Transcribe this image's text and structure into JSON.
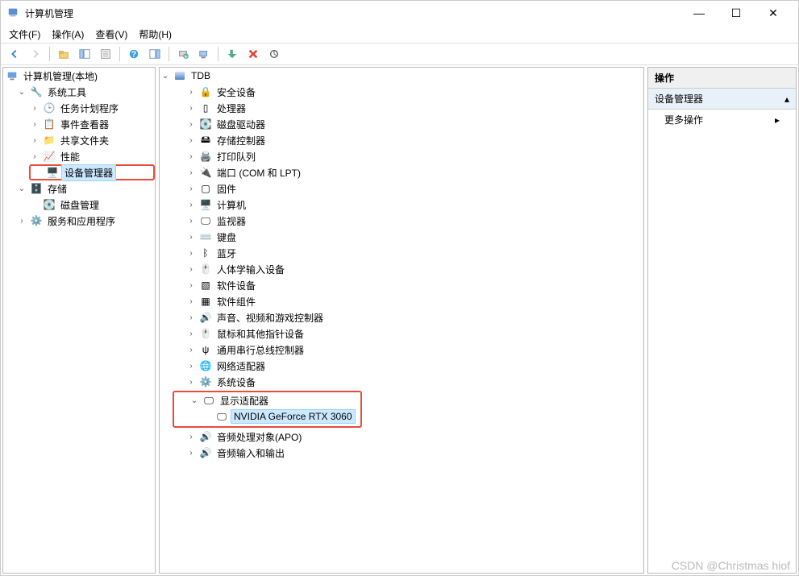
{
  "window": {
    "title": "计算机管理"
  },
  "menus": {
    "file": "文件(F)",
    "action": "操作(A)",
    "view": "查看(V)",
    "help": "帮助(H)"
  },
  "left_tree": {
    "root": "计算机管理(本地)",
    "system_tools": "系统工具",
    "task_scheduler": "任务计划程序",
    "event_viewer": "事件查看器",
    "shared_folders": "共享文件夹",
    "performance": "性能",
    "device_manager": "设备管理器",
    "storage": "存储",
    "disk_mgmt": "磁盘管理",
    "services_apps": "服务和应用程序"
  },
  "device_tree": {
    "root": "TDB",
    "items": [
      "安全设备",
      "处理器",
      "磁盘驱动器",
      "存储控制器",
      "打印队列",
      "端口 (COM 和 LPT)",
      "固件",
      "计算机",
      "监视器",
      "键盘",
      "蓝牙",
      "人体学输入设备",
      "软件设备",
      "软件组件",
      "声音、视频和游戏控制器",
      "鼠标和其他指针设备",
      "通用串行总线控制器",
      "网络适配器",
      "系统设备"
    ],
    "display_adapters": "显示适配器",
    "gpu": "NVIDIA GeForce RTX 3060",
    "items_after": [
      "音频处理对象(APO)",
      "音频输入和输出"
    ]
  },
  "actions": {
    "header": "操作",
    "category": "设备管理器",
    "more": "更多操作"
  },
  "watermark": "CSDN @Christmas hiof"
}
